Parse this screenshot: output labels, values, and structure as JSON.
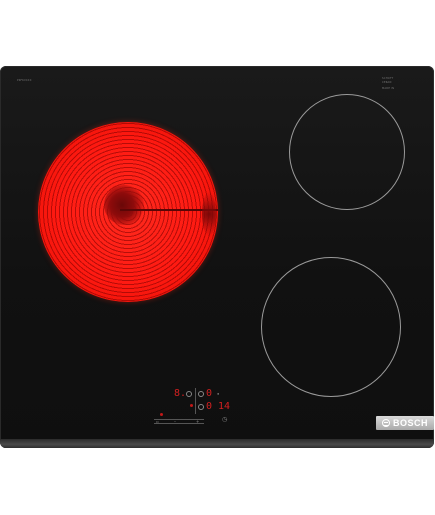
{
  "cooktop": {
    "model_code": "PKF6XXXX",
    "label_a": "SCHOTT",
    "label_b": "CERAN",
    "label_c": "MADE IN",
    "brand": "BOSCH"
  },
  "zones": [
    {
      "name": "front-left",
      "state": "on"
    },
    {
      "name": "rear-right",
      "state": "off"
    },
    {
      "name": "front-right",
      "state": "off"
    }
  ],
  "control_panel": {
    "power_display": "8.",
    "zone_indicator": "0",
    "timer_zero": "0",
    "timer_display": "14"
  },
  "colors": {
    "hot_zone": "#ff1a12",
    "display_red": "#d22020",
    "glass": "#111111",
    "brand_plate": "#c4c4c4"
  }
}
